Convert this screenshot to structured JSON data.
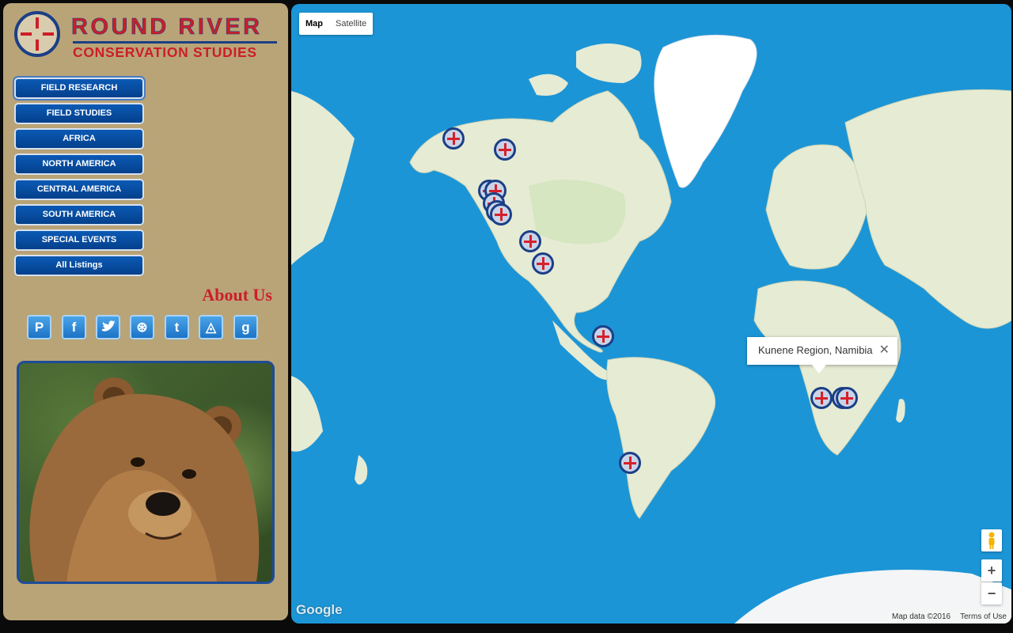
{
  "logo": {
    "title": "ROUND RIVER",
    "subtitle": "CONSERVATION STUDIES"
  },
  "nav": [
    {
      "label": "FIELD RESEARCH",
      "active": true
    },
    {
      "label": "FIELD STUDIES"
    },
    {
      "label": "AFRICA"
    },
    {
      "label": "NORTH AMERICA"
    },
    {
      "label": "CENTRAL AMERICA"
    },
    {
      "label": "SOUTH AMERICA"
    },
    {
      "label": "SPECIAL EVENTS"
    },
    {
      "label": "All Listings"
    }
  ],
  "about": "About Us",
  "social": [
    {
      "icon": "pinterest-icon",
      "glyph": "P"
    },
    {
      "icon": "facebook-icon",
      "glyph": "f"
    },
    {
      "icon": "twitter-icon",
      "glyph": "t"
    },
    {
      "icon": "dribbble-icon",
      "glyph": "⊛"
    },
    {
      "icon": "tumblr-icon",
      "glyph": "t"
    },
    {
      "icon": "delicious-icon",
      "glyph": "◬"
    },
    {
      "icon": "google-plus-icon",
      "glyph": "g"
    }
  ],
  "photo": {
    "alt": "bear-photo"
  },
  "map": {
    "type_controls": {
      "map": "Map",
      "satellite": "Satellite",
      "selected": "Map"
    },
    "infowindow": {
      "text": "Kunene Region, Namibia"
    },
    "google_logo": "Google",
    "attribution": {
      "data": "Map data ©2016",
      "terms": "Terms of Use"
    },
    "zoom_in": "+",
    "zoom_out": "−",
    "colors": {
      "water": "#1c95d6",
      "land": "#e9edd8",
      "marker_ring": "#1b3f86",
      "marker_cross": "#d6202a"
    }
  }
}
